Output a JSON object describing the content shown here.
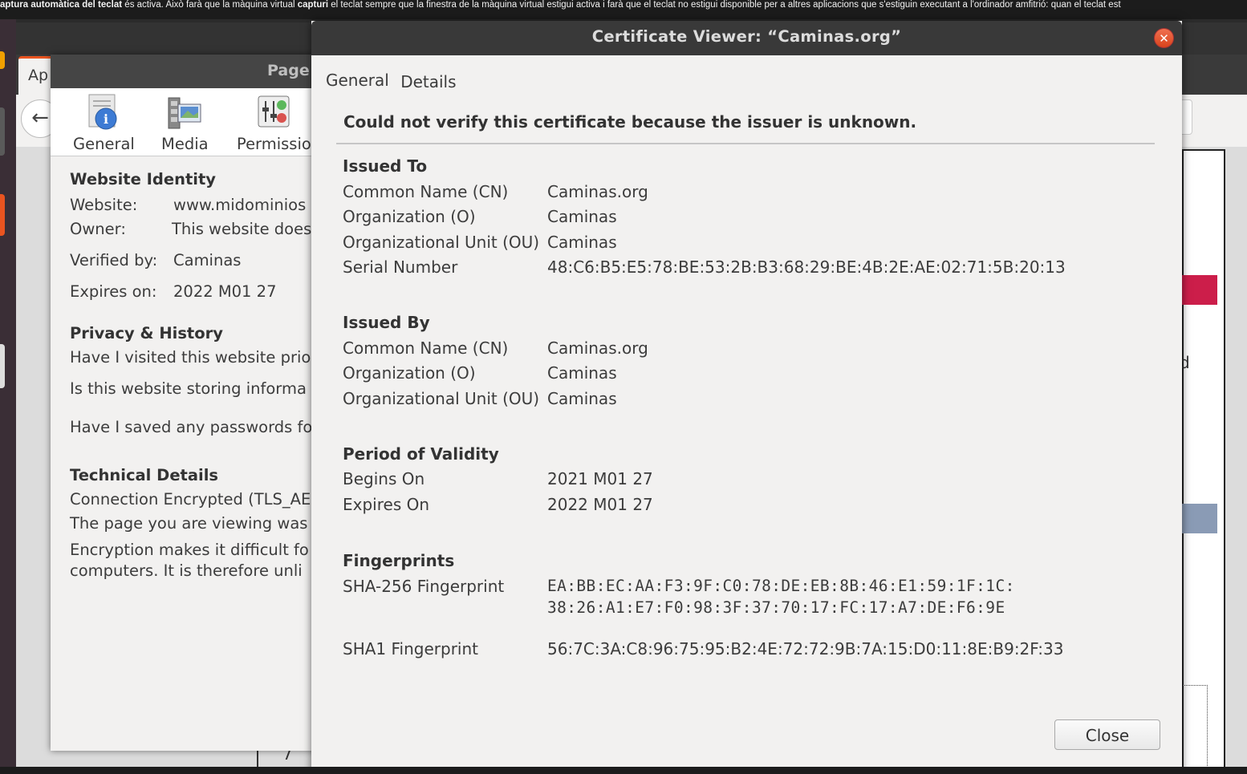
{
  "vm_notification": {
    "bold1": "aptura automàtica del teclat",
    "text1": " és activa. Això farà que la màquina virtual ",
    "bold2": "capturi",
    "text2": " el teclat sempre que la finestra de la màquina virtual estigui activa i farà que el teclat no estigui disponible per a altres aplicacions que s'estiguin executant a l'ordinador amfitrió: quan el teclat est"
  },
  "background_browser": {
    "tab_label": "Ap",
    "back_icon": "arrow-left-icon",
    "stray_char": "d",
    "stray_char2": "7"
  },
  "page_info": {
    "title": "Page",
    "tabs": [
      {
        "label": "General",
        "icon": "info-icon"
      },
      {
        "label": "Media",
        "icon": "media-icon"
      },
      {
        "label": "Permissio",
        "icon": "permissions-icon"
      }
    ],
    "website_identity": {
      "heading": "Website Identity",
      "website_label": "Website:",
      "website_value": "www.midominios",
      "owner_label": "Owner:",
      "owner_value": "This website does",
      "verified_label": "Verified by:",
      "verified_value": "Caminas",
      "expires_label": "Expires on:",
      "expires_value": "2022 M01 27"
    },
    "privacy": {
      "heading": "Privacy & History",
      "q1": "Have I visited this website prio",
      "q2": "Is this website storing informa",
      "q3": "Have I saved any passwords fo"
    },
    "technical": {
      "heading": "Technical Details",
      "line1": "Connection Encrypted (TLS_AE",
      "line2": "The page you are viewing was e",
      "line3": "Encryption makes it difficult fo",
      "line4": "computers. It is therefore unli"
    }
  },
  "cert_viewer": {
    "title": "Certificate Viewer: “Caminas.org”",
    "tabs": [
      "General",
      "Details"
    ],
    "warning": "Could not verify this certificate because the issuer is unknown.",
    "issued_to": {
      "heading": "Issued To",
      "cn_label": "Common Name (CN)",
      "cn": "Caminas.org",
      "o_label": "Organization (O)",
      "o": "Caminas",
      "ou_label": "Organizational Unit (OU)",
      "ou": "Caminas",
      "serial_label": "Serial Number",
      "serial": "48:C6:B5:E5:78:BE:53:2B:B3:68:29:BE:4B:2E:AE:02:71:5B:20:13"
    },
    "issued_by": {
      "heading": "Issued By",
      "cn_label": "Common Name (CN)",
      "cn": "Caminas.org",
      "o_label": "Organization (O)",
      "o": "Caminas",
      "ou_label": "Organizational Unit (OU)",
      "ou": "Caminas"
    },
    "validity": {
      "heading": "Period of Validity",
      "begins_label": "Begins On",
      "begins": "2021 M01 27",
      "expires_label": "Expires On",
      "expires": "2022 M01 27"
    },
    "fingerprints": {
      "heading": "Fingerprints",
      "sha256_label": "SHA-256 Fingerprint",
      "sha256_line1": "EA:BB:EC:AA:F3:9F:C0:78:DE:EB:8B:46:E1:59:1F:1C:",
      "sha256_line2": "38:26:A1:E7:F0:98:3F:37:70:17:FC:17:A7:DE:F6:9E",
      "sha1_label": "SHA1 Fingerprint",
      "sha1": "56:7C:3A:C8:96:75:95:B2:4E:72:72:9B:7A:15:D0:11:8E:B9:2F:33"
    },
    "close_label": "Close"
  }
}
